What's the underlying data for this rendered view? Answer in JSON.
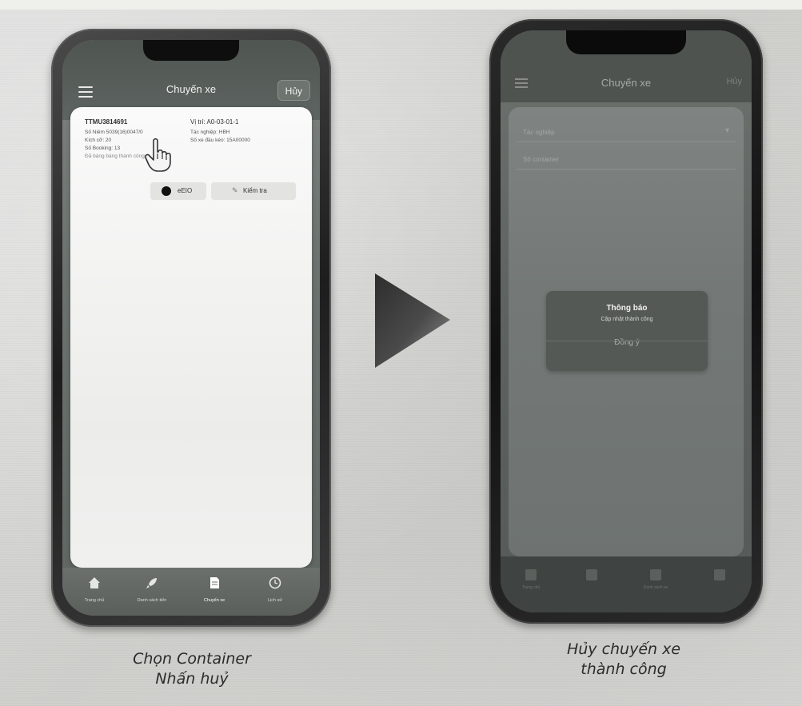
{
  "left_phone": {
    "header_title": "Chuyến xe",
    "cancel_label": "Hủy",
    "container": {
      "id": "TTMU3814691",
      "seal_line": "Số Niêm 5039(16)0047/0",
      "size_line": "Kích cỡ: 20",
      "booking_line": "Số Booking: 13",
      "status_line": "Đã bàng bàng thành công",
      "position": "Vị trí: A0-03-01-1",
      "business_line": "Tác nghiệp: HBH",
      "truck_line": "Số xe đầu kéo: 15A00000"
    },
    "eir_label": "eEIO",
    "check_label": "Kiểm tra",
    "tabs": [
      "Trang chủ",
      "Danh sách tiến",
      "Chuyến xe",
      "Lịch sử"
    ]
  },
  "right_phone": {
    "header_title": "Chuyến xe",
    "cancel_label": "Hủy",
    "field_1": "Tác nghiệp",
    "field_2": "Số container",
    "dialog": {
      "title": "Thông báo",
      "message": "Cập nhật thành công",
      "button": "Đồng ý"
    },
    "tabs": [
      "Trang chủ",
      "",
      "Danh sách xe",
      ""
    ]
  },
  "captions": {
    "left_line1": "Chọn Container",
    "left_line2": "Nhấn huỷ",
    "right_line1": "Hủy chuyến xe",
    "right_line2": "thành công"
  },
  "icons": {
    "menu": "menu-icon",
    "home": "home-icon",
    "list": "rocket-icon",
    "trip": "document-icon",
    "history": "clock-icon",
    "hand": "hand-pointer-icon",
    "arrow": "play-arrow-icon"
  }
}
